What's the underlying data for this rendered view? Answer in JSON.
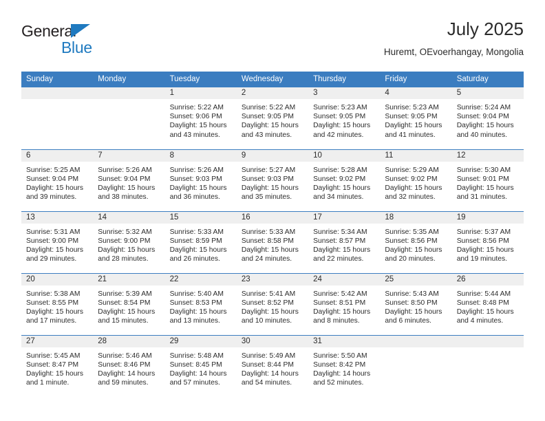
{
  "brand": {
    "name_top": "General",
    "name_bottom": "Blue",
    "accent_color": "#1f7ac0"
  },
  "header": {
    "title": "July 2025",
    "subtitle": "Huremt, OEvoerhangay, Mongolia"
  },
  "theme": {
    "header_blue": "#3b7dc0",
    "daynum_band": "#efefef",
    "text": "#2b2b2b"
  },
  "weekday_headers": [
    "Sunday",
    "Monday",
    "Tuesday",
    "Wednesday",
    "Thursday",
    "Friday",
    "Saturday"
  ],
  "weeks": [
    [
      {
        "day": "",
        "blank": true
      },
      {
        "day": "",
        "blank": true
      },
      {
        "day": "1",
        "sunrise": "Sunrise: 5:22 AM",
        "sunset": "Sunset: 9:06 PM",
        "daylight": "Daylight: 15 hours and 43 minutes."
      },
      {
        "day": "2",
        "sunrise": "Sunrise: 5:22 AM",
        "sunset": "Sunset: 9:05 PM",
        "daylight": "Daylight: 15 hours and 43 minutes."
      },
      {
        "day": "3",
        "sunrise": "Sunrise: 5:23 AM",
        "sunset": "Sunset: 9:05 PM",
        "daylight": "Daylight: 15 hours and 42 minutes."
      },
      {
        "day": "4",
        "sunrise": "Sunrise: 5:23 AM",
        "sunset": "Sunset: 9:05 PM",
        "daylight": "Daylight: 15 hours and 41 minutes."
      },
      {
        "day": "5",
        "sunrise": "Sunrise: 5:24 AM",
        "sunset": "Sunset: 9:04 PM",
        "daylight": "Daylight: 15 hours and 40 minutes."
      }
    ],
    [
      {
        "day": "6",
        "sunrise": "Sunrise: 5:25 AM",
        "sunset": "Sunset: 9:04 PM",
        "daylight": "Daylight: 15 hours and 39 minutes."
      },
      {
        "day": "7",
        "sunrise": "Sunrise: 5:26 AM",
        "sunset": "Sunset: 9:04 PM",
        "daylight": "Daylight: 15 hours and 38 minutes."
      },
      {
        "day": "8",
        "sunrise": "Sunrise: 5:26 AM",
        "sunset": "Sunset: 9:03 PM",
        "daylight": "Daylight: 15 hours and 36 minutes."
      },
      {
        "day": "9",
        "sunrise": "Sunrise: 5:27 AM",
        "sunset": "Sunset: 9:03 PM",
        "daylight": "Daylight: 15 hours and 35 minutes."
      },
      {
        "day": "10",
        "sunrise": "Sunrise: 5:28 AM",
        "sunset": "Sunset: 9:02 PM",
        "daylight": "Daylight: 15 hours and 34 minutes."
      },
      {
        "day": "11",
        "sunrise": "Sunrise: 5:29 AM",
        "sunset": "Sunset: 9:02 PM",
        "daylight": "Daylight: 15 hours and 32 minutes."
      },
      {
        "day": "12",
        "sunrise": "Sunrise: 5:30 AM",
        "sunset": "Sunset: 9:01 PM",
        "daylight": "Daylight: 15 hours and 31 minutes."
      }
    ],
    [
      {
        "day": "13",
        "sunrise": "Sunrise: 5:31 AM",
        "sunset": "Sunset: 9:00 PM",
        "daylight": "Daylight: 15 hours and 29 minutes."
      },
      {
        "day": "14",
        "sunrise": "Sunrise: 5:32 AM",
        "sunset": "Sunset: 9:00 PM",
        "daylight": "Daylight: 15 hours and 28 minutes."
      },
      {
        "day": "15",
        "sunrise": "Sunrise: 5:33 AM",
        "sunset": "Sunset: 8:59 PM",
        "daylight": "Daylight: 15 hours and 26 minutes."
      },
      {
        "day": "16",
        "sunrise": "Sunrise: 5:33 AM",
        "sunset": "Sunset: 8:58 PM",
        "daylight": "Daylight: 15 hours and 24 minutes."
      },
      {
        "day": "17",
        "sunrise": "Sunrise: 5:34 AM",
        "sunset": "Sunset: 8:57 PM",
        "daylight": "Daylight: 15 hours and 22 minutes."
      },
      {
        "day": "18",
        "sunrise": "Sunrise: 5:35 AM",
        "sunset": "Sunset: 8:56 PM",
        "daylight": "Daylight: 15 hours and 20 minutes."
      },
      {
        "day": "19",
        "sunrise": "Sunrise: 5:37 AM",
        "sunset": "Sunset: 8:56 PM",
        "daylight": "Daylight: 15 hours and 19 minutes."
      }
    ],
    [
      {
        "day": "20",
        "sunrise": "Sunrise: 5:38 AM",
        "sunset": "Sunset: 8:55 PM",
        "daylight": "Daylight: 15 hours and 17 minutes."
      },
      {
        "day": "21",
        "sunrise": "Sunrise: 5:39 AM",
        "sunset": "Sunset: 8:54 PM",
        "daylight": "Daylight: 15 hours and 15 minutes."
      },
      {
        "day": "22",
        "sunrise": "Sunrise: 5:40 AM",
        "sunset": "Sunset: 8:53 PM",
        "daylight": "Daylight: 15 hours and 13 minutes."
      },
      {
        "day": "23",
        "sunrise": "Sunrise: 5:41 AM",
        "sunset": "Sunset: 8:52 PM",
        "daylight": "Daylight: 15 hours and 10 minutes."
      },
      {
        "day": "24",
        "sunrise": "Sunrise: 5:42 AM",
        "sunset": "Sunset: 8:51 PM",
        "daylight": "Daylight: 15 hours and 8 minutes."
      },
      {
        "day": "25",
        "sunrise": "Sunrise: 5:43 AM",
        "sunset": "Sunset: 8:50 PM",
        "daylight": "Daylight: 15 hours and 6 minutes."
      },
      {
        "day": "26",
        "sunrise": "Sunrise: 5:44 AM",
        "sunset": "Sunset: 8:48 PM",
        "daylight": "Daylight: 15 hours and 4 minutes."
      }
    ],
    [
      {
        "day": "27",
        "sunrise": "Sunrise: 5:45 AM",
        "sunset": "Sunset: 8:47 PM",
        "daylight": "Daylight: 15 hours and 1 minute."
      },
      {
        "day": "28",
        "sunrise": "Sunrise: 5:46 AM",
        "sunset": "Sunset: 8:46 PM",
        "daylight": "Daylight: 14 hours and 59 minutes."
      },
      {
        "day": "29",
        "sunrise": "Sunrise: 5:48 AM",
        "sunset": "Sunset: 8:45 PM",
        "daylight": "Daylight: 14 hours and 57 minutes."
      },
      {
        "day": "30",
        "sunrise": "Sunrise: 5:49 AM",
        "sunset": "Sunset: 8:44 PM",
        "daylight": "Daylight: 14 hours and 54 minutes."
      },
      {
        "day": "31",
        "sunrise": "Sunrise: 5:50 AM",
        "sunset": "Sunset: 8:42 PM",
        "daylight": "Daylight: 14 hours and 52 minutes."
      },
      {
        "day": "",
        "blank": true
      },
      {
        "day": "",
        "blank": true
      }
    ]
  ]
}
